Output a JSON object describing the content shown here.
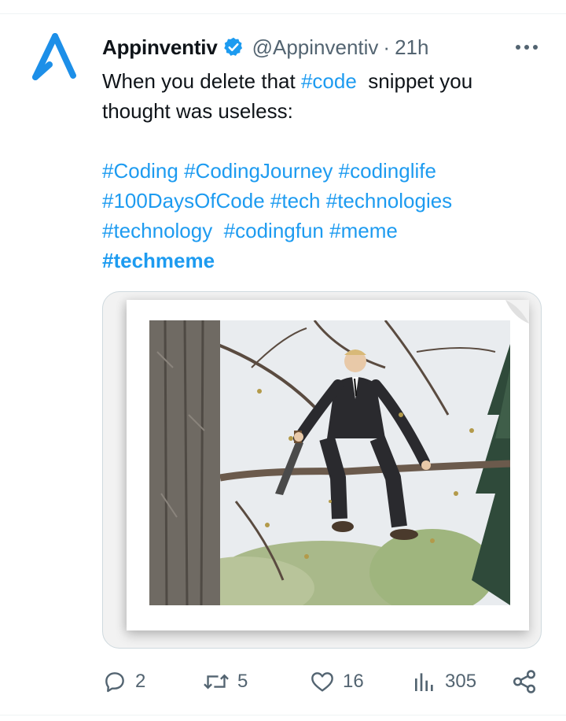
{
  "tweet": {
    "author_name": "Appinventiv",
    "handle": "@Appinventiv",
    "separator": "·",
    "time": "21h",
    "text": {
      "line1_prefix": "When you delete that ",
      "line1_tag": "#code",
      "line1_suffix": "  snippet you",
      "line2": "thought was useless:",
      "tags_line1": "#Coding #CodingJourney #codinglife",
      "tags_line2": "#100DaysOfCode #tech #technologies",
      "tags_line3": "#technology  #codingfun #meme",
      "tags_line4": "#techmeme"
    }
  },
  "actions": {
    "replies": "2",
    "retweets": "5",
    "likes": "16",
    "views": "305"
  },
  "colors": {
    "accent": "#1d9bf0",
    "text": "#0f1419",
    "muted": "#536471",
    "logo": "#1d8fe8"
  },
  "icons": [
    "app-logo-icon",
    "verified-badge-icon",
    "more-options-icon",
    "reply-icon",
    "retweet-icon",
    "like-icon",
    "views-icon",
    "share-icon"
  ]
}
